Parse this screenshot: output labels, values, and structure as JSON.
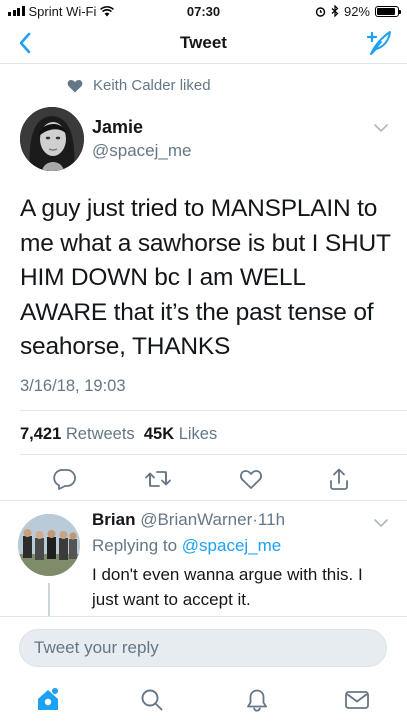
{
  "status_bar": {
    "carrier": "Sprint Wi-Fi",
    "time": "07:30",
    "battery": "92%",
    "battery_level": 0.92
  },
  "nav": {
    "title": "Tweet"
  },
  "social_context": {
    "text": "Keith Calder liked"
  },
  "tweet": {
    "author_name": "Jamie",
    "author_handle": "@spacej_me",
    "text": "A guy just tried to MANSPLAIN to me what a sawhorse is but I SHUT HIM DOWN bc I am WELL AWARE that it’s the past tense of seahorse, THANKS",
    "timestamp": "3/16/18, 19:03",
    "retweet_count": "7,421",
    "retweet_label": "Retweets",
    "like_count": "45K",
    "like_label": "Likes"
  },
  "reply": {
    "author_name": "Brian",
    "author_handle": "@BrianWarner",
    "separator": "·",
    "age": "11h",
    "replying_to_label": "Replying to",
    "replying_to_handle": "@spacej_me",
    "text": "I don't even wanna argue with this. I just want to accept it."
  },
  "composer": {
    "placeholder": "Tweet your reply"
  },
  "colors": {
    "accent": "#1da1f2",
    "text_primary": "#14171a",
    "text_secondary": "#657786",
    "divider": "#e1e8ed"
  },
  "icons": {
    "back": "chevron-left-icon",
    "compose": "compose-feather-icon",
    "like_context": "heart-filled-icon",
    "reply": "reply-bubble-icon",
    "retweet": "retweet-icon",
    "like": "heart-icon",
    "share": "share-icon",
    "home": "home-icon",
    "search": "search-icon",
    "notifications": "bell-icon",
    "messages": "envelope-icon"
  }
}
